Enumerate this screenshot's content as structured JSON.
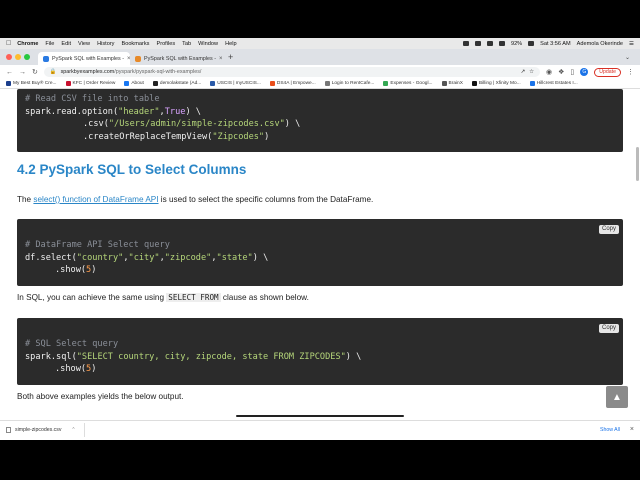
{
  "menubar": {
    "apple_icon": "apple-icon",
    "items": [
      "Chrome",
      "File",
      "Edit",
      "View",
      "History",
      "Bookmarks",
      "Profiles",
      "Tab",
      "Window",
      "Help"
    ],
    "battery": "92%",
    "time": "Sat 3:56 AM",
    "user": "Ademola Okerinde"
  },
  "tabs": [
    {
      "title": "PySpark SQL with Examples -",
      "active": true
    },
    {
      "title": "PySpark SQL with Examples -",
      "active": false
    }
  ],
  "toolbar": {
    "url_host": "sparkbyexamples.com",
    "url_path": "/pyspark/pyspark-sql-with-examples/",
    "avatar_letter": "G",
    "update_label": "Update"
  },
  "bookmarks": [
    "My Best Buy® Cre...",
    "KFC | Order Review",
    "About",
    "demolakstate (Ad...",
    "USCIS | myUSCIS...",
    "DS4A | Empowe...",
    "Login to RentCafe...",
    "Expenses - Googl...",
    "BrainX",
    "Billing | Xfinity Mo...",
    "Hillcrest Estates I..."
  ],
  "page": {
    "block1": {
      "comment": "# Read CSV file into table",
      "line2a": "spark.read.option(",
      "line2s": "\"header\"",
      "line2b": ",",
      "line2k": "True",
      "line2c": ") \\",
      "line3a": ".csv(",
      "line3s": "\"/Users/admin/simple-zipcodes.csv\"",
      "line3b": ") \\",
      "line4a": ".createOrReplaceTempView(",
      "line4s": "\"Zipcodes\"",
      "line4b": ")"
    },
    "heading": "4.2 PySpark SQL to Select Columns",
    "para1_pre": "The ",
    "para1_link": "select() function of DataFrame API",
    "para1_post": " is used to select the specific columns from the DataFrame.",
    "block2": {
      "copy": "Copy",
      "comment": "# DataFrame API Select query",
      "line2a": "df.select(",
      "s1": "\"country\"",
      "s2": "\"city\"",
      "s3": "\"zipcode\"",
      "s4": "\"state\"",
      "line2b": ") \\",
      "line3a": ".show(",
      "n": "5",
      "line3b": ")"
    },
    "para2_pre": "In SQL, you can achieve the same using ",
    "para2_code": "SELECT FROM",
    "para2_post": " clause as shown below.",
    "block3": {
      "copy": "Copy",
      "comment": "# SQL Select query",
      "line2a": "spark.sql(",
      "s": "\"SELECT country, city, zipcode, state FROM ZIPCODES\"",
      "line2b": ") \\",
      "line3a": ".show(",
      "n": "5",
      "line3b": ")"
    },
    "para3": "Both above examples yields the below output."
  },
  "downloads": {
    "file": "simple-zipcodes.csv",
    "show_all": "Show All"
  }
}
